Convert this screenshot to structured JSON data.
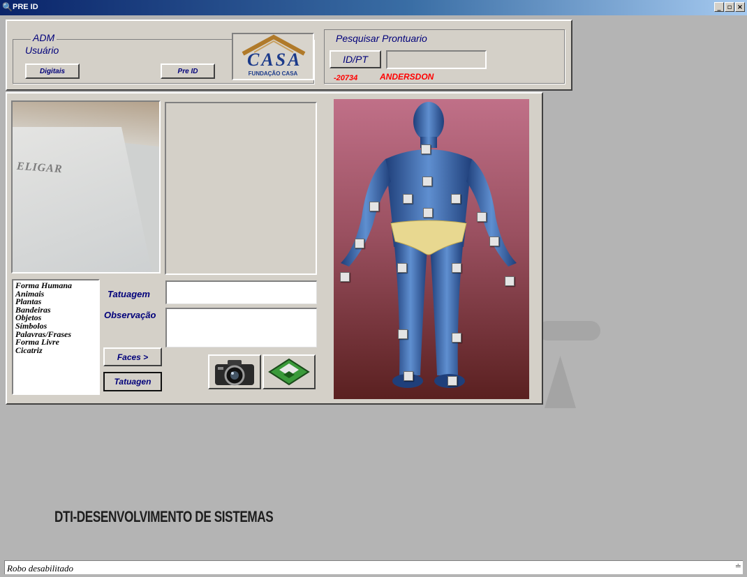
{
  "window": {
    "title": "PRE ID",
    "title_icon": "magnifier-icon",
    "controls": {
      "minimize": "_",
      "maximize": "▫",
      "close": "×"
    }
  },
  "header": {
    "user_group": {
      "title": "ADM",
      "subtitle": "Usuário",
      "digitais_button": "Digitais",
      "preid_button": "Pre ID"
    },
    "logo": {
      "brand": "CASA",
      "caption": "FUNDAÇÃO CASA"
    },
    "search": {
      "title": "Pesquisar Prontuario",
      "idpt_button": "ID/PT",
      "input_value": "",
      "record_number": "-20734",
      "record_name": "ANDERSDON"
    }
  },
  "tattoo_form": {
    "categories": [
      "Forma Humana",
      "Animais",
      "Plantas",
      "Bandeiras",
      "Objetos",
      "Símbolos",
      "Palavras/Frases",
      "Forma Livre",
      "Cicatriz"
    ],
    "tatuagem_label": "Tatuagem",
    "tatuagem_value": "",
    "observacao_label": "Observação",
    "observacao_value": "",
    "faces_button": "Faces >",
    "tatuagen_button": "Tatuagen",
    "camera_icon": "camera-icon",
    "save_icon": "floppy-disk-icon"
  },
  "webcam": {
    "visible_text": "ELIGAR"
  },
  "body_map": {
    "marker_count": 19
  },
  "watermark": {
    "text": "DTI-DESENVOLVIMENTO DE SISTEMAS"
  },
  "status": {
    "text": "Robo desabilitado",
    "grip": "≐"
  },
  "colors": {
    "title_bar": "#0a246a",
    "window_bg": "#b4b4b4",
    "panel_bg": "#d4d0c8",
    "label_color": "#00007a",
    "record_color": "#ff0000",
    "body_bg_top": "#c07088",
    "body_bg_bottom": "#5a2020",
    "body_figure": "#2e5fa8"
  }
}
